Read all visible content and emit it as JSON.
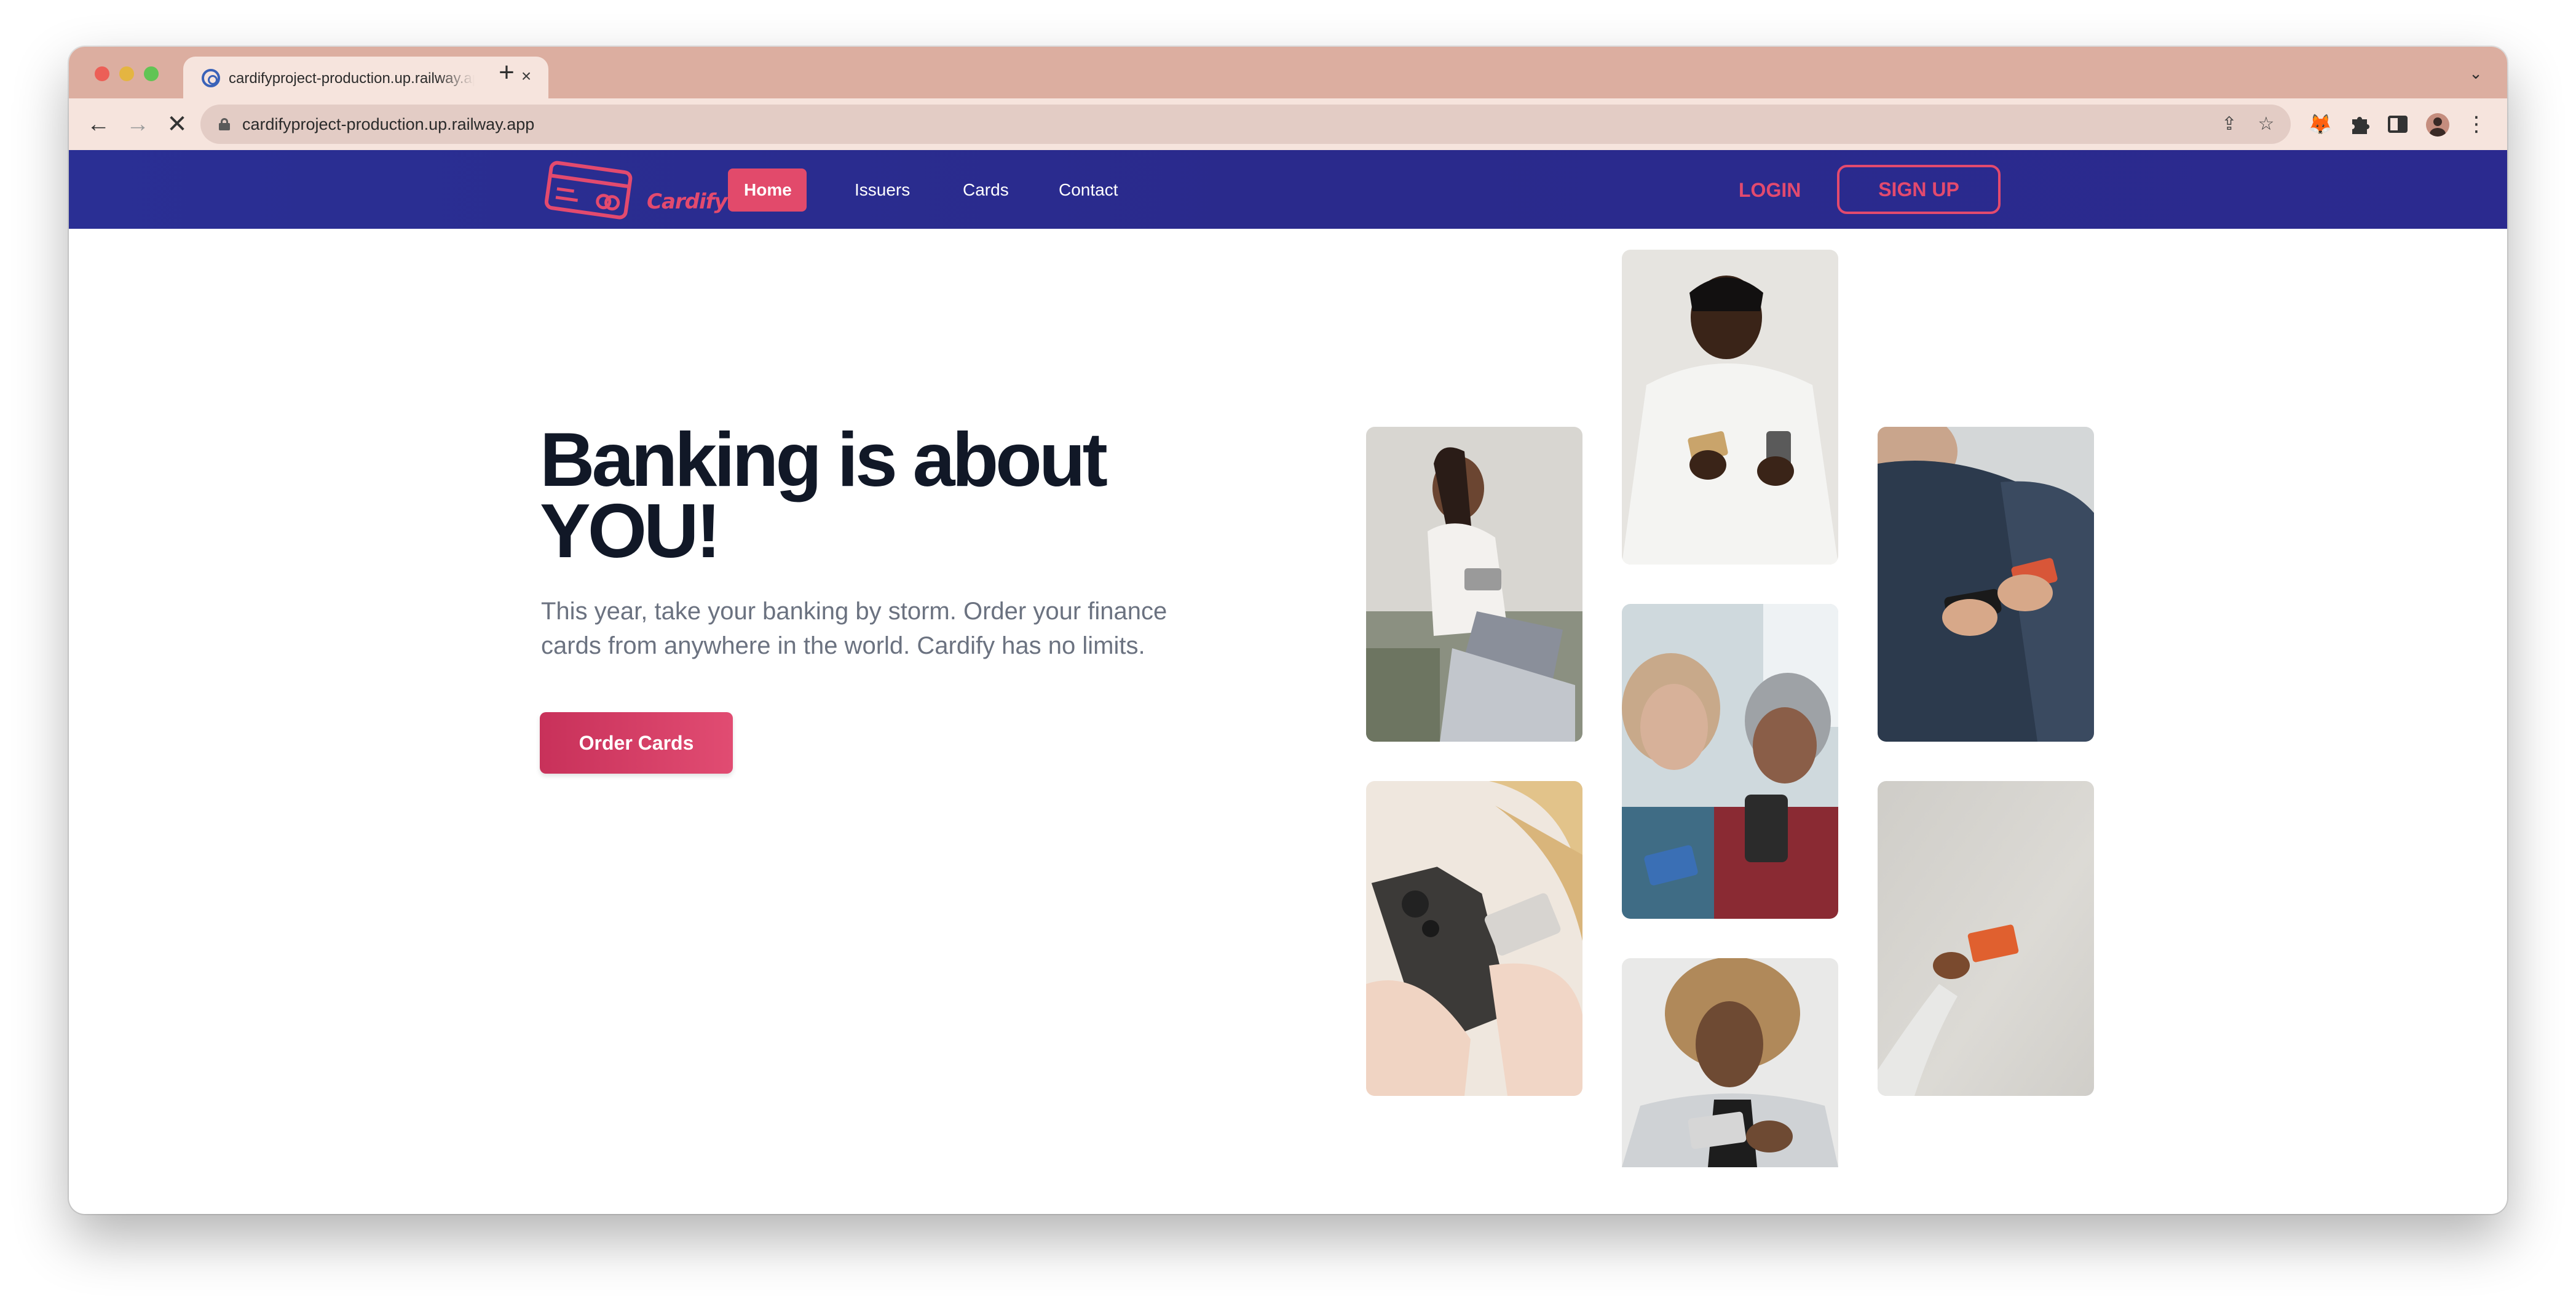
{
  "browser": {
    "tab": {
      "title": "cardifyproject-production.up.railway.app",
      "close_label": "×"
    },
    "new_tab_label": "+",
    "tab_list_label": "⌄",
    "address": {
      "url": "cardifyproject-production.up.railway.app"
    },
    "nav": {
      "back": "←",
      "forward": "→",
      "stop": "✕"
    }
  },
  "site": {
    "brand": "Cardify",
    "nav_links": [
      {
        "label": "Home",
        "active": true
      },
      {
        "label": "Issuers",
        "active": false
      },
      {
        "label": "Cards",
        "active": false
      },
      {
        "label": "Contact",
        "active": false
      }
    ],
    "login_label": "LOGIN",
    "signup_label": "SIGN UP",
    "accent_color": "#e34a6e",
    "navbar_color": "#2a2a8c"
  },
  "hero": {
    "title_line1": "Banking is about",
    "title_line2": "YOU!",
    "subtitle": "This year, take your banking by storm. Order your finance cards from anywhere in the world. Cardify has no limits.",
    "cta_label": "Order Cards"
  },
  "photos": [
    {
      "name": "woman-laptop-card-photo"
    },
    {
      "name": "hands-phone-card-photo"
    },
    {
      "name": "man-phone-card-photo"
    },
    {
      "name": "elderly-couple-phone-photo"
    },
    {
      "name": "man-afro-card-photo"
    },
    {
      "name": "person-jacket-phone-photo"
    },
    {
      "name": "hand-orange-card-photo"
    }
  ]
}
